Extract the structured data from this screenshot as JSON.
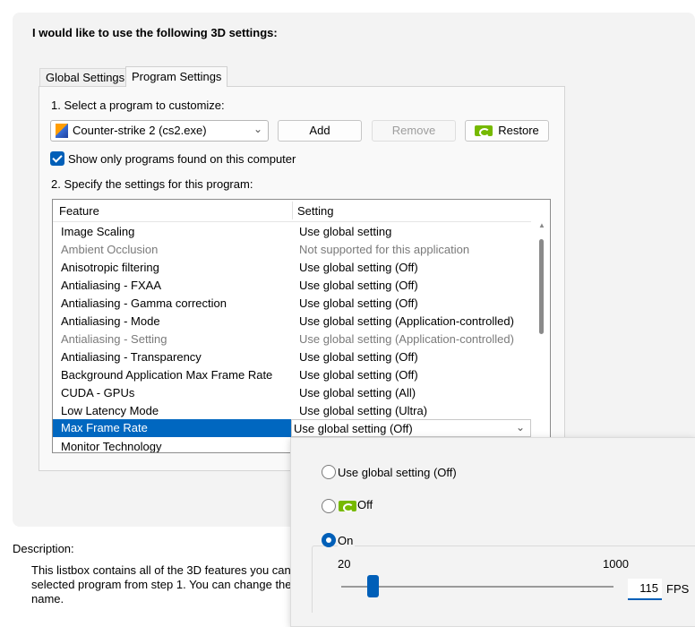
{
  "heading": "I would like to use the following 3D settings:",
  "tabs": {
    "global": "Global Settings",
    "program": "Program Settings"
  },
  "step1": "1. Select a program to customize:",
  "program_combo": {
    "value": "Counter-strike 2 (cs2.exe)",
    "icon": "cs2-icon"
  },
  "buttons": {
    "add": "Add",
    "remove": "Remove",
    "restore": "Restore"
  },
  "show_only_checkbox": {
    "label": "Show only programs found on this computer",
    "checked": true
  },
  "step2": "2. Specify the settings for this program:",
  "table": {
    "columns": [
      "Feature",
      "Setting"
    ],
    "rows": [
      {
        "feature": "Image Scaling",
        "setting": "Use global setting",
        "disabled": false
      },
      {
        "feature": "Ambient Occlusion",
        "setting": "Not supported for this application",
        "disabled": true
      },
      {
        "feature": "Anisotropic filtering",
        "setting": "Use global setting (Off)",
        "disabled": false
      },
      {
        "feature": "Antialiasing - FXAA",
        "setting": "Use global setting (Off)",
        "disabled": false
      },
      {
        "feature": "Antialiasing - Gamma correction",
        "setting": "Use global setting (Off)",
        "disabled": false
      },
      {
        "feature": "Antialiasing - Mode",
        "setting": "Use global setting (Application-controlled)",
        "disabled": false
      },
      {
        "feature": "Antialiasing - Setting",
        "setting": "Use global setting (Application-controlled)",
        "disabled": true
      },
      {
        "feature": "Antialiasing - Transparency",
        "setting": "Use global setting (Off)",
        "disabled": false
      },
      {
        "feature": "Background Application Max Frame Rate",
        "setting": "Use global setting (Off)",
        "disabled": false
      },
      {
        "feature": "CUDA - GPUs",
        "setting": "Use global setting (All)",
        "disabled": false
      },
      {
        "feature": "Low Latency Mode",
        "setting": "Use global setting (Ultra)",
        "disabled": false
      },
      {
        "feature": "Max Frame Rate",
        "setting": "Use global setting (Off)",
        "disabled": false,
        "selected": true
      },
      {
        "feature": "Monitor Technology",
        "setting": "",
        "disabled": false
      }
    ]
  },
  "description": {
    "title": "Description:",
    "lines": [
      "This listbox contains all of the 3D features you can",
      "selected program from step 1. You can change the",
      "name."
    ]
  },
  "popup": {
    "option_global": "Use global setting (Off)",
    "option_off": "Off",
    "option_on": "On",
    "selected_option": "On",
    "slider_min": "20",
    "slider_max": "1000",
    "slider_value": "115",
    "unit": "FPS"
  },
  "colors": {
    "accent": "#005fb8",
    "selection": "#0067c0",
    "nvidia_green": "#76b900"
  }
}
